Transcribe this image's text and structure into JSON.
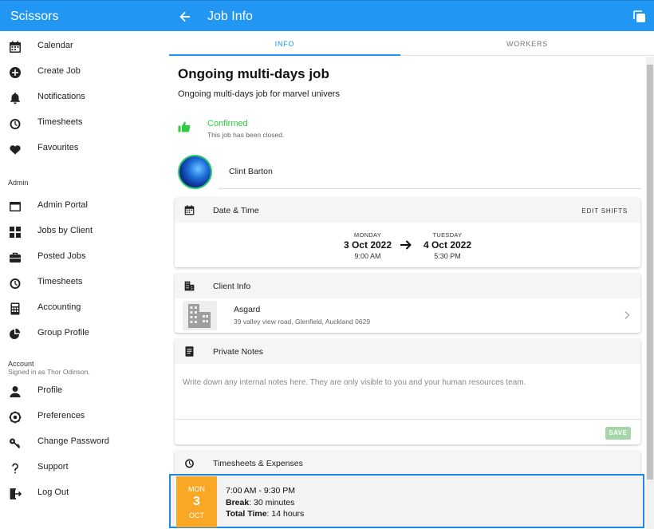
{
  "app": {
    "title": "Scissors"
  },
  "header": {
    "title": "Job Info"
  },
  "sidebar": {
    "main_items": [
      {
        "label": "Calendar",
        "icon": "calendar-icon"
      },
      {
        "label": "Create Job",
        "icon": "add-circle-icon"
      },
      {
        "label": "Notifications",
        "icon": "bell-icon"
      },
      {
        "label": "Timesheets",
        "icon": "stopwatch-icon"
      },
      {
        "label": "Favourites",
        "icon": "heart-icon"
      }
    ],
    "admin_title": "Admin",
    "admin_items": [
      {
        "label": "Admin Portal",
        "icon": "window-icon"
      },
      {
        "label": "Jobs by Client",
        "icon": "grid-icon"
      },
      {
        "label": "Posted Jobs",
        "icon": "briefcase-icon"
      },
      {
        "label": "Timesheets",
        "icon": "stopwatch-icon"
      },
      {
        "label": "Accounting",
        "icon": "calculator-icon"
      },
      {
        "label": "Group Profile",
        "icon": "pie-chart-icon"
      }
    ],
    "account_title": "Account",
    "account_subtitle": "Signed in as Thor Odinson.",
    "account_items": [
      {
        "label": "Profile",
        "icon": "person-icon"
      },
      {
        "label": "Preferences",
        "icon": "settings-icon"
      },
      {
        "label": "Change Password",
        "icon": "key-icon"
      },
      {
        "label": "Support",
        "icon": "question-icon"
      },
      {
        "label": "Log Out",
        "icon": "logout-icon"
      }
    ]
  },
  "tabs": [
    {
      "label": "INFO",
      "active": true
    },
    {
      "label": "WORKERS",
      "active": false
    }
  ],
  "job": {
    "title": "Ongoing multi-days job",
    "description": "Ongoing multi-days job for marvel univers",
    "status": "Confirmed",
    "status_note": "This job has been closed.",
    "worker_name": "Clint Barton"
  },
  "datetime_card": {
    "title": "Date & Time",
    "action": "EDIT SHIFTS",
    "start": {
      "day": "MONDAY",
      "date": "3 Oct 2022",
      "time": "9:00 AM"
    },
    "end": {
      "day": "TUESDAY",
      "date": "4 Oct 2022",
      "time": "5:30 PM"
    }
  },
  "client_card": {
    "title": "Client Info",
    "name": "Asgard",
    "address": "39 valley view road, Glenfield, Auckland 0629"
  },
  "notes_card": {
    "title": "Private Notes",
    "placeholder": "Write down any internal notes here. They are only visible to you and your human resources team.",
    "save_label": "SAVE"
  },
  "timesheets_card": {
    "title": "Timesheets & Expenses"
  },
  "timesheet_entry": {
    "dow": "MON",
    "day": "3",
    "month": "OCT",
    "hours": "7:00 AM - 9:30 PM",
    "break_label": "Break",
    "break_value": ": 30 minutes",
    "total_label": "Total Time",
    "total_value": ": 14 hours"
  },
  "colors": {
    "primary": "#2196f3",
    "confirmed": "#2ecc40",
    "date_badge": "#f9a825",
    "save_disabled": "#a5d6a7",
    "highlight_border": "#1e88e5"
  }
}
